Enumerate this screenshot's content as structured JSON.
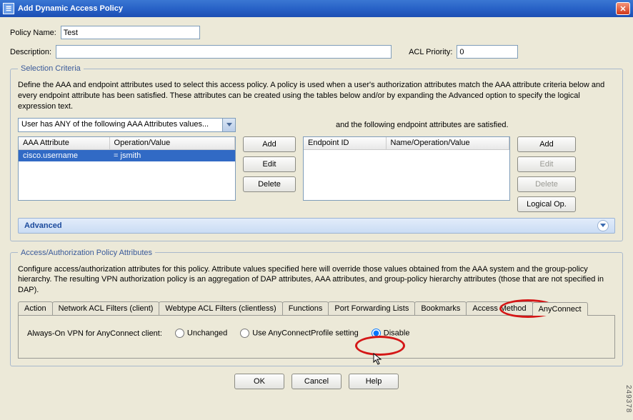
{
  "window": {
    "title": "Add Dynamic Access Policy"
  },
  "policy_name": {
    "label": "Policy Name:",
    "value": "Test"
  },
  "description": {
    "label": "Description:",
    "value": ""
  },
  "acl_priority": {
    "label": "ACL Priority:",
    "value": "0"
  },
  "selection": {
    "legend": "Selection Criteria",
    "text": "Define the AAA and endpoint attributes used to select this access policy. A policy is used when a user's authorization attributes match the AAA attribute criteria below and every endpoint attribute has been satisfied. These attributes can be created using the tables below and/or by expanding the Advanced option to specify the logical expression text.",
    "dropdown": "User has ANY of the following AAA Attributes values...",
    "endpoint_note": "and the following endpoint attributes are satisfied.",
    "aaa_headers": [
      "AAA Attribute",
      "Operation/Value"
    ],
    "aaa_rows": [
      {
        "attr": "cisco.username",
        "op": "=   jsmith"
      }
    ],
    "endpoint_headers": [
      "Endpoint ID",
      "Name/Operation/Value"
    ],
    "btn_add": "Add",
    "btn_edit": "Edit",
    "btn_delete": "Delete",
    "btn_logical": "Logical Op.",
    "advanced": "Advanced"
  },
  "access": {
    "legend": "Access/Authorization Policy Attributes",
    "text": "Configure access/authorization attributes for this policy. Attribute values specified here will override those values obtained from the AAA system and the group-policy hierarchy. The resulting VPN authorization policy is an aggregation of DAP attributes, AAA attributes, and group-policy hierarchy attributes (those that are not specified in DAP).",
    "tabs": [
      "Action",
      "Network ACL Filters (client)",
      "Webtype ACL Filters (clientless)",
      "Functions",
      "Port Forwarding Lists",
      "Bookmarks",
      "Access Method",
      "AnyConnect"
    ],
    "always_on_label": "Always-On VPN for AnyConnect client:",
    "radio_unchanged": "Unchanged",
    "radio_profile": "Use AnyConnectProfile setting",
    "radio_disable": "Disable"
  },
  "bottom": {
    "ok": "OK",
    "cancel": "Cancel",
    "help": "Help"
  },
  "figure_id": "249378"
}
